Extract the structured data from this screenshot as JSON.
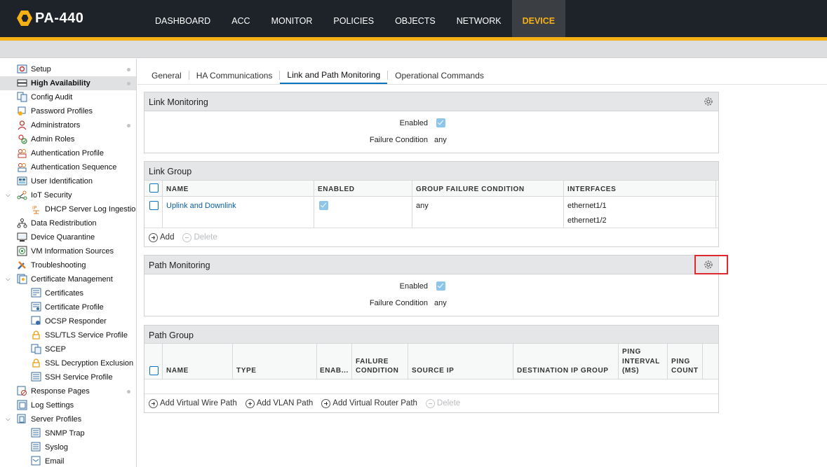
{
  "app": {
    "title": "PA-440"
  },
  "nav": {
    "tabs": [
      {
        "label": "DASHBOARD"
      },
      {
        "label": "ACC"
      },
      {
        "label": "MONITOR"
      },
      {
        "label": "POLICIES"
      },
      {
        "label": "OBJECTS"
      },
      {
        "label": "NETWORK"
      },
      {
        "label": "DEVICE"
      }
    ],
    "active": "DEVICE"
  },
  "sidebar": {
    "items": [
      {
        "label": "Setup",
        "icon": "setup-icon"
      },
      {
        "label": "High Availability",
        "icon": "ha-icon",
        "selected": true
      },
      {
        "label": "Config Audit",
        "icon": "config-audit-icon"
      },
      {
        "label": "Password Profiles",
        "icon": "password-icon"
      },
      {
        "label": "Administrators",
        "icon": "admin-icon"
      },
      {
        "label": "Admin Roles",
        "icon": "admin-role-icon"
      },
      {
        "label": "Authentication Profile",
        "icon": "auth-profile-icon"
      },
      {
        "label": "Authentication Sequence",
        "icon": "auth-seq-icon"
      },
      {
        "label": "User Identification",
        "icon": "user-id-icon"
      },
      {
        "label": "IoT Security",
        "icon": "iot-icon"
      },
      {
        "label": "DHCP Server Log Ingestion",
        "icon": "dhcp-icon"
      },
      {
        "label": "Data Redistribution",
        "icon": "redistribution-icon"
      },
      {
        "label": "Device Quarantine",
        "icon": "quarantine-icon"
      },
      {
        "label": "VM Information Sources",
        "icon": "vm-icon"
      },
      {
        "label": "Troubleshooting",
        "icon": "troubleshoot-icon"
      },
      {
        "label": "Certificate Management",
        "icon": "cert-mgmt-icon"
      },
      {
        "label": "Certificates",
        "icon": "certificate-icon"
      },
      {
        "label": "Certificate Profile",
        "icon": "cert-profile-icon"
      },
      {
        "label": "OCSP Responder",
        "icon": "ocsp-icon"
      },
      {
        "label": "SSL/TLS Service Profile",
        "icon": "lock-icon"
      },
      {
        "label": "SCEP",
        "icon": "scep-icon"
      },
      {
        "label": "SSL Decryption Exclusion",
        "icon": "lock-icon"
      },
      {
        "label": "SSH Service Profile",
        "icon": "ssh-icon"
      },
      {
        "label": "Response Pages",
        "icon": "response-pages-icon"
      },
      {
        "label": "Log Settings",
        "icon": "log-settings-icon"
      },
      {
        "label": "Server Profiles",
        "icon": "server-profiles-icon"
      },
      {
        "label": "SNMP Trap",
        "icon": "snmp-icon"
      },
      {
        "label": "Syslog",
        "icon": "syslog-icon"
      },
      {
        "label": "Email",
        "icon": "email-icon"
      }
    ]
  },
  "subtabs": [
    {
      "label": "General"
    },
    {
      "label": "HA Communications"
    },
    {
      "label": "Link and Path Monitoring"
    },
    {
      "label": "Operational Commands"
    }
  ],
  "link_monitoring": {
    "title": "Link Monitoring",
    "enabled_label": "Enabled",
    "enabled": true,
    "failure_condition_label": "Failure Condition",
    "failure_condition": "any"
  },
  "link_group": {
    "title": "Link Group",
    "columns": {
      "name": "NAME",
      "enabled": "ENABLED",
      "group_failure_condition": "GROUP FAILURE CONDITION",
      "interfaces": "INTERFACES"
    },
    "rows": [
      {
        "name": "Uplink and Downlink",
        "enabled": true,
        "group_failure_condition": "any",
        "interfaces": [
          "ethernet1/1",
          "ethernet1/2"
        ]
      }
    ],
    "actions": {
      "add": "Add",
      "delete": "Delete"
    }
  },
  "path_monitoring": {
    "title": "Path Monitoring",
    "enabled_label": "Enabled",
    "enabled": true,
    "failure_condition_label": "Failure Condition",
    "failure_condition": "any"
  },
  "path_group": {
    "title": "Path Group",
    "columns": {
      "name": "NAME",
      "type": "TYPE",
      "enabled": "ENAB...",
      "failure_condition_1": "FAILURE",
      "failure_condition_2": "CONDITION",
      "source_ip": "SOURCE IP",
      "destination_ip_group": "DESTINATION IP GROUP",
      "ping_interval_1": "PING",
      "ping_interval_2": "INTERVAL",
      "ping_interval_3": "(MS)",
      "ping_count_1": "PING",
      "ping_count_2": "COUNT"
    },
    "actions": {
      "add_vwire": "Add Virtual Wire Path",
      "add_vlan": "Add VLAN Path",
      "add_vrouter": "Add Virtual Router Path",
      "delete": "Delete"
    }
  },
  "colors": {
    "accent": "#f5b015",
    "topbar": "#1e232a",
    "link": "#0a5fa8",
    "checkbox": "#8ec6ea",
    "highlight": "#e0292e"
  }
}
